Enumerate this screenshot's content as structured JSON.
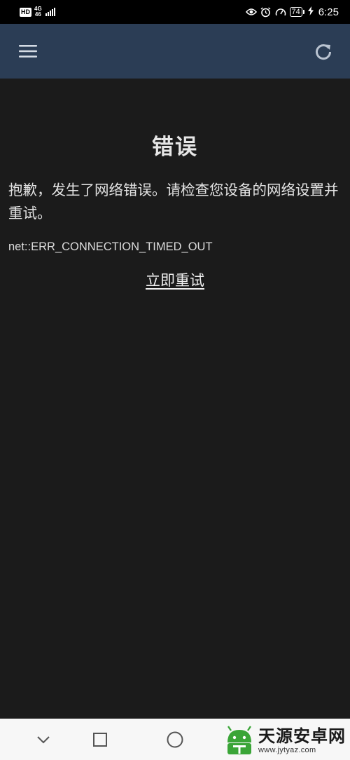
{
  "status_bar": {
    "hd": "HD",
    "network": "4G",
    "network_sub": "46",
    "battery": "74",
    "time": "6:25"
  },
  "app_bar": {
    "menu_icon": "hamburger-menu-icon",
    "refresh_icon": "refresh-icon"
  },
  "error": {
    "title": "错误",
    "message": "抱歉，发生了网络错误。请检查您设备的网络设置并重试。",
    "code": "net::ERR_CONNECTION_TIMED_OUT",
    "retry_label": "立即重试"
  },
  "nav_bar": {
    "back_icon": "chevron-down-icon",
    "recent_icon": "square-icon",
    "home_icon": "circle-icon"
  },
  "watermark": {
    "name": "天源安卓网",
    "url": "www.jytyaz.com"
  },
  "colors": {
    "app_bar": "#2b3d55",
    "background": "#1b1b1b",
    "status_bar": "#000000",
    "nav_bar": "#f7f7f7",
    "watermark_green": "#3aa537"
  }
}
